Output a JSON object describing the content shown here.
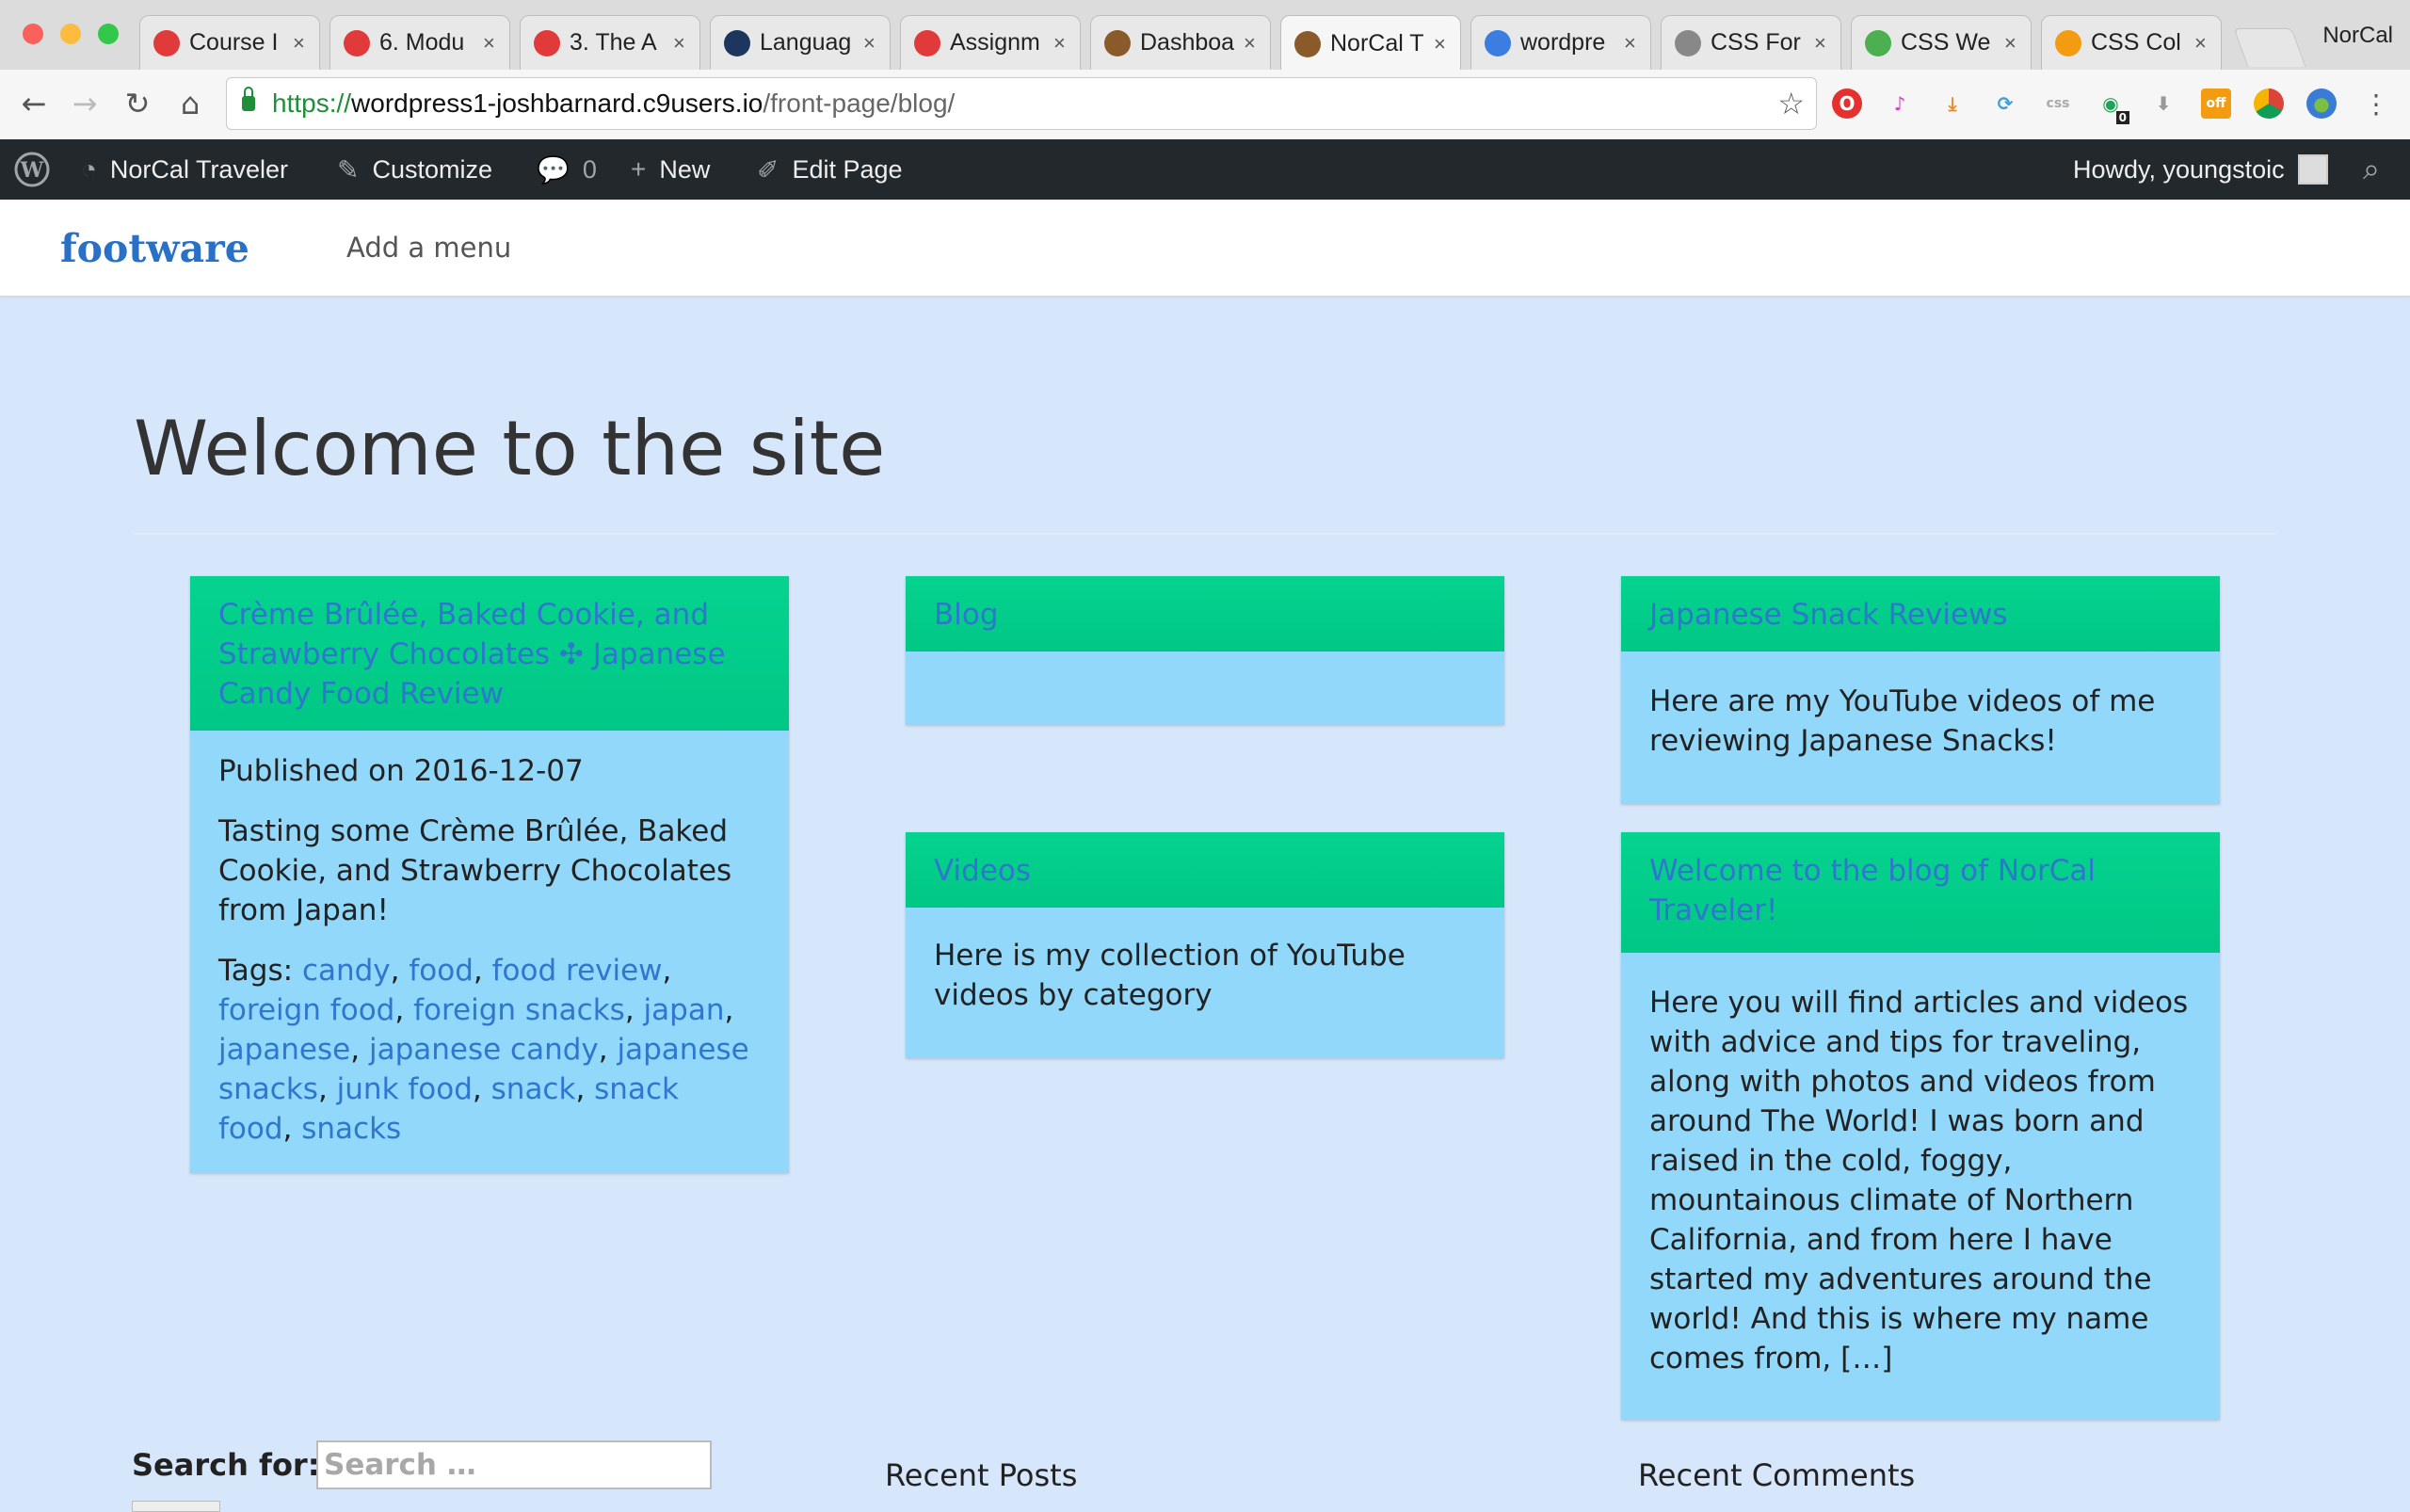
{
  "browser": {
    "tabs": [
      {
        "label": "Course I",
        "favicon": "gear-red-icon",
        "color": "#e03a3a"
      },
      {
        "label": "6. Modu",
        "favicon": "gear-red-icon",
        "color": "#e03a3a"
      },
      {
        "label": "3. The A",
        "favicon": "gear-red-icon",
        "color": "#e03a3a"
      },
      {
        "label": "Languag",
        "favicon": "less-icon",
        "color": "#1d365d"
      },
      {
        "label": "Assignm",
        "favicon": "gear-red-icon",
        "color": "#e03a3a"
      },
      {
        "label": "Dashboa",
        "favicon": "briefcase-icon",
        "color": "#8a5a2b"
      },
      {
        "label": "NorCal T",
        "favicon": "briefcase-icon",
        "color": "#8a5a2b"
      },
      {
        "label": "wordpre",
        "favicon": "cloud9-icon",
        "color": "#3b7de0"
      },
      {
        "label": "CSS For",
        "favicon": "document-icon",
        "color": "#888888"
      },
      {
        "label": "CSS We",
        "favicon": "w3-icon",
        "color": "#4caf50"
      },
      {
        "label": "CSS Col",
        "favicon": "search-orange-icon",
        "color": "#f39c12"
      }
    ],
    "profile_name": "NorCal",
    "url": {
      "protocol": "https://",
      "host": "wordpress1-joshbarnard.c9users.io",
      "path": "/front-page/blog/"
    },
    "extension_badge": "0",
    "extension_off_label": "off"
  },
  "adminbar": {
    "site_name": "NorCal Traveler",
    "customize": "Customize",
    "comments_count": "0",
    "new_label": "New",
    "edit_page": "Edit Page",
    "howdy": "Howdy, youngstoic"
  },
  "site": {
    "logo": "footware",
    "menu_placeholder": "Add a menu"
  },
  "page": {
    "title": "Welcome to the site"
  },
  "cards": {
    "post": {
      "title": "Crème Brûlée, Baked Cookie, and Strawberry Chocolates ✣ Japanese Candy Food Review",
      "published": "Published on 2016-12-07",
      "excerpt": "Tasting some Crème Brûlée, Baked Cookie, and Strawberry Chocolates from Japan!",
      "tags_label": "Tags: ",
      "tags": [
        "candy",
        "food",
        "food review",
        "foreign food",
        "foreign snacks",
        "japan",
        "japanese",
        "japanese candy",
        "japanese snacks",
        "junk food",
        "snack",
        "snack food",
        "snacks"
      ]
    },
    "blog": {
      "title": "Blog"
    },
    "videos": {
      "title": "Videos",
      "text": "Here is my collection of YouTube videos by category"
    },
    "snacks": {
      "title": "Japanese Snack Reviews",
      "text": "Here are my YouTube videos of me reviewing Japanese Snacks!"
    },
    "welcome": {
      "title": "Welcome to the blog of NorCal Traveler!",
      "text": "Here you will find articles and videos with advice and tips for traveling, along with photos and videos from around The World! I was born and raised in the cold, foggy, mountainous climate of Northern California, and from here I have started my adventures around the world!  And this is where my name comes from, […]"
    }
  },
  "sidebar": {
    "search_label": "Search for:",
    "search_placeholder": "Search …",
    "recent_posts": "Recent Posts",
    "recent_comments": "Recent Comments"
  }
}
